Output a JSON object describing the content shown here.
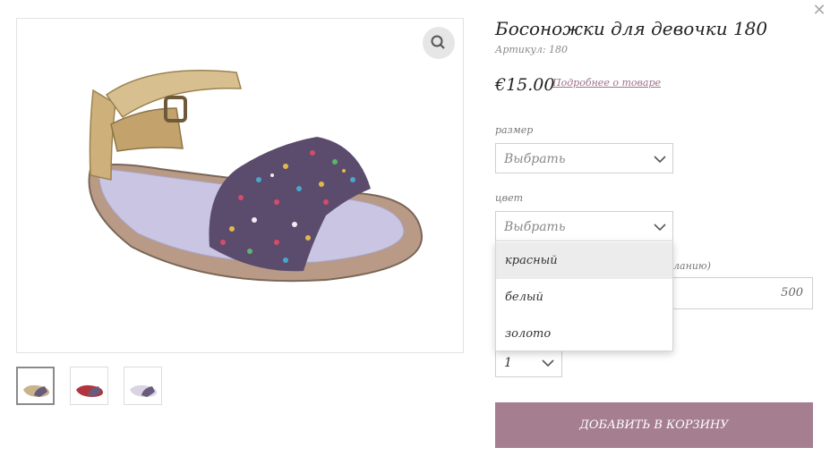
{
  "product": {
    "title": "Босоножки для девочки 180",
    "sku": "Артикул: 180",
    "price": "€15.00",
    "details_link": "Подробнее о товаре"
  },
  "size": {
    "label": "размер",
    "value": "Выбрать"
  },
  "color": {
    "label": "цвет",
    "value": "Выбрать",
    "options": [
      "красный",
      "белый",
      "золото"
    ],
    "hovered_option": "красный"
  },
  "extra": {
    "label_fragment": "желанию)",
    "value": "500"
  },
  "quantity": {
    "value": "1"
  },
  "cart": {
    "button_label": "ДОБАВИТЬ В КОРЗИНУ"
  },
  "colors": {
    "accent": "#a57e90",
    "link": "#9d7088"
  },
  "icons": {
    "close": "close-icon",
    "zoom": "zoom-icon",
    "chevron": "chevron-down-icon"
  }
}
